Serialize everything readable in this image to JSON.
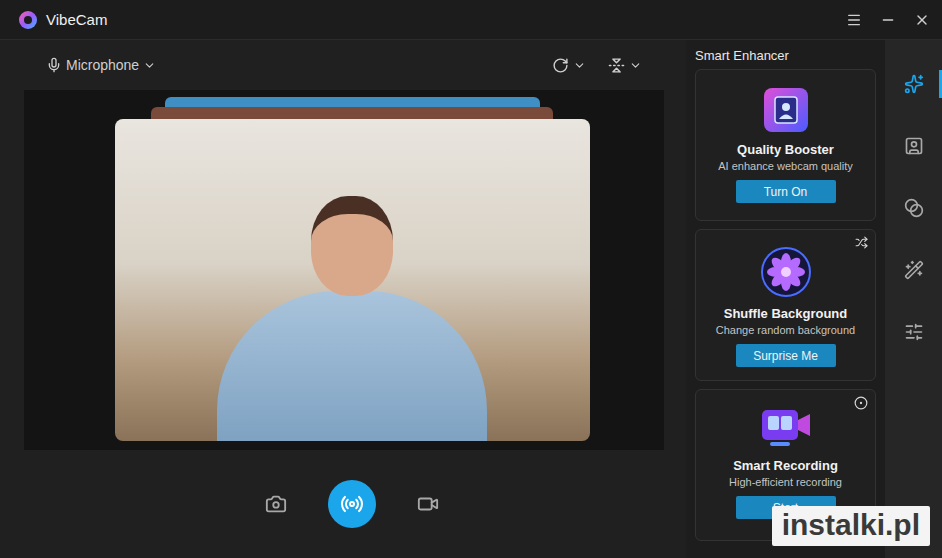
{
  "window": {
    "title": "VibeCam"
  },
  "toolbar": {
    "microphone": "Microphone"
  },
  "controls": [
    {
      "action": "snapshot",
      "selected": false
    },
    {
      "action": "live",
      "selected": true
    },
    {
      "action": "record",
      "selected": false
    }
  ],
  "panel": {
    "title": "Smart Enhancer",
    "cards": [
      {
        "title": "Quality Booster",
        "subtitle": "AI enhance webcam quality",
        "button": "Turn On",
        "kind": "booster",
        "corner": "none"
      },
      {
        "title": "Shuffle Background",
        "subtitle": "Change random background",
        "button": "Surprise Me",
        "kind": "shuffle",
        "corner": "shuffle"
      },
      {
        "title": "Smart Recording",
        "subtitle": "High-efficient recording",
        "button": "Start",
        "kind": "recording",
        "corner": "settings"
      }
    ]
  },
  "sidebar": {
    "items": [
      {
        "selected": true
      },
      {
        "selected": false
      },
      {
        "selected": false
      },
      {
        "selected": false
      },
      {
        "selected": false
      }
    ]
  },
  "watermark": "instalki.pl"
}
